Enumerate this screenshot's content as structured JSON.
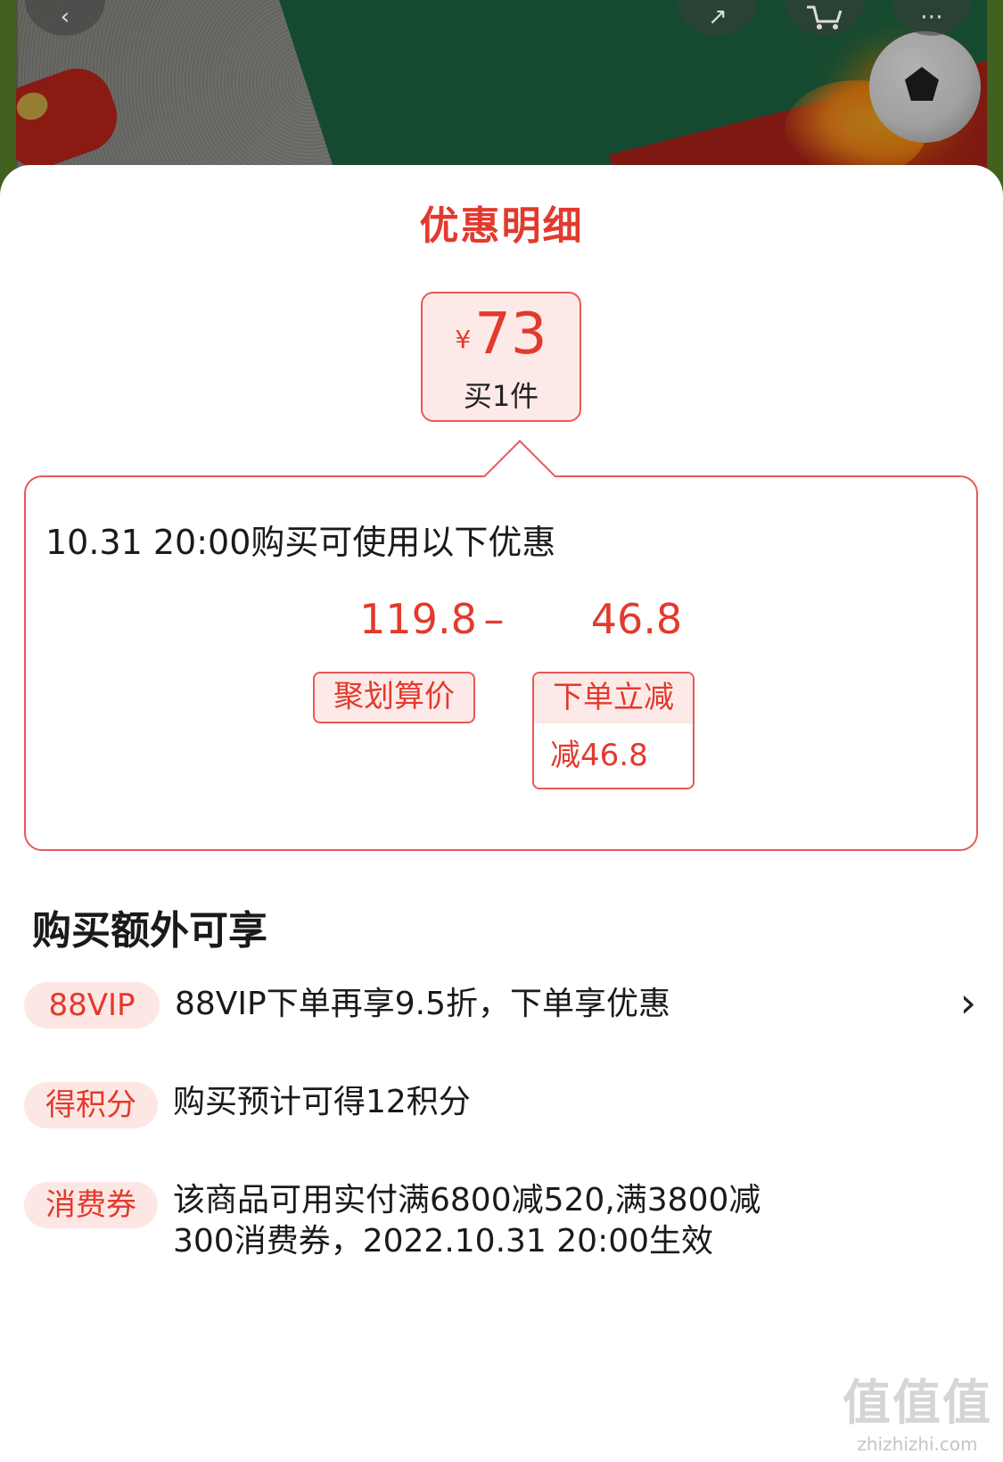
{
  "sheet": {
    "title": "优惠明细"
  },
  "price_box": {
    "currency": "¥",
    "amount": "73",
    "quantity": "买1件"
  },
  "detail": {
    "heading": "10.31 20:00购买可使用以下优惠",
    "original_value": "119.8",
    "operator": "–",
    "discount_value": "46.8",
    "original_tag": "聚划算价",
    "discount_tag_title": "下单立减",
    "discount_tag_detail": "减46.8"
  },
  "extra": {
    "title": "购买额外可享",
    "items": [
      {
        "badge": "88VIP",
        "text": "88VIP下单再享9.5折，下单享优惠",
        "has_arrow": true
      },
      {
        "badge": "得积分",
        "text": "购买预计可得12积分"
      },
      {
        "badge": "消费券",
        "text_line1": "该商品可用实付满6800减520,满3800减",
        "text_line2": "300消费券，2022.10.31 20:00生效"
      }
    ]
  },
  "watermark": {
    "logo": "值值值",
    "url": "zhizhizhi.com"
  },
  "colors": {
    "accent_red": "#e23a2d",
    "tag_bg": "#fde9e8",
    "border_red": "#e8585a"
  },
  "icons": {
    "back": "chevron-left-icon",
    "share": "share-icon",
    "cart": "cart-icon",
    "more": "more-icon",
    "row_arrow": "chevron-right-icon"
  }
}
